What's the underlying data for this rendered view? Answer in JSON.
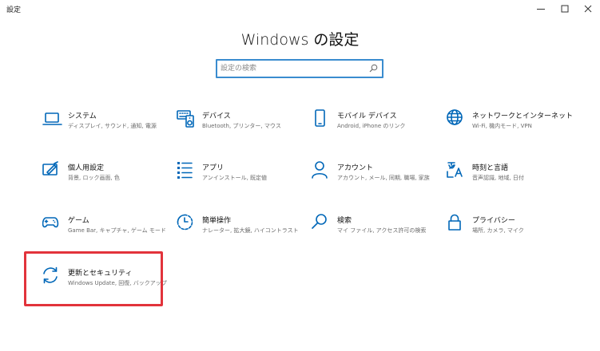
{
  "window": {
    "title": "設定",
    "minimize_icon": "minimize-icon",
    "maximize_icon": "maximize-icon",
    "close_icon": "close-icon"
  },
  "header": {
    "title": "Windows の設定"
  },
  "search": {
    "placeholder": "設定の検索",
    "value": "",
    "icon": "search-icon"
  },
  "colors": {
    "accent": "#0067b8",
    "search_border": "#3a8ccf",
    "highlight": "#e2333b"
  },
  "tiles": [
    {
      "title": "システム",
      "desc": "ディスプレイ, サウンド, 通知, 電源",
      "icon": "laptop-icon"
    },
    {
      "title": "デバイス",
      "desc": "Bluetooth, プリンター, マウス",
      "icon": "keyboard-speaker-icon"
    },
    {
      "title": "モバイル デバイス",
      "desc": "Android, iPhone のリンク",
      "icon": "phone-icon"
    },
    {
      "title": "ネットワークとインターネット",
      "desc": "Wi-Fi, 機内モード, VPN",
      "icon": "globe-icon"
    },
    {
      "title": "個人用設定",
      "desc": "背景, ロック画面, 色",
      "icon": "personalization-icon"
    },
    {
      "title": "アプリ",
      "desc": "アンインストール, 既定値",
      "icon": "apps-list-icon"
    },
    {
      "title": "アカウント",
      "desc": "アカウント, メール, 同期, 職場, 家族",
      "icon": "person-icon"
    },
    {
      "title": "時刻と言語",
      "desc": "音声認識, 地域, 日付",
      "icon": "time-language-icon"
    },
    {
      "title": "ゲーム",
      "desc": "Game Bar, キャプチャ, ゲーム モード",
      "icon": "gamepad-icon"
    },
    {
      "title": "簡単操作",
      "desc": "ナレーター, 拡大鏡, ハイコントラスト",
      "icon": "ease-of-access-icon"
    },
    {
      "title": "検索",
      "desc": "マイ ファイル, アクセス許可の検索",
      "icon": "search-magnifier-icon"
    },
    {
      "title": "プライバシー",
      "desc": "場所, カメラ, マイク",
      "icon": "lock-icon"
    },
    {
      "title": "更新とセキュリティ",
      "desc": "Windows Update, 回復, バックアップ",
      "icon": "update-sync-icon"
    }
  ]
}
